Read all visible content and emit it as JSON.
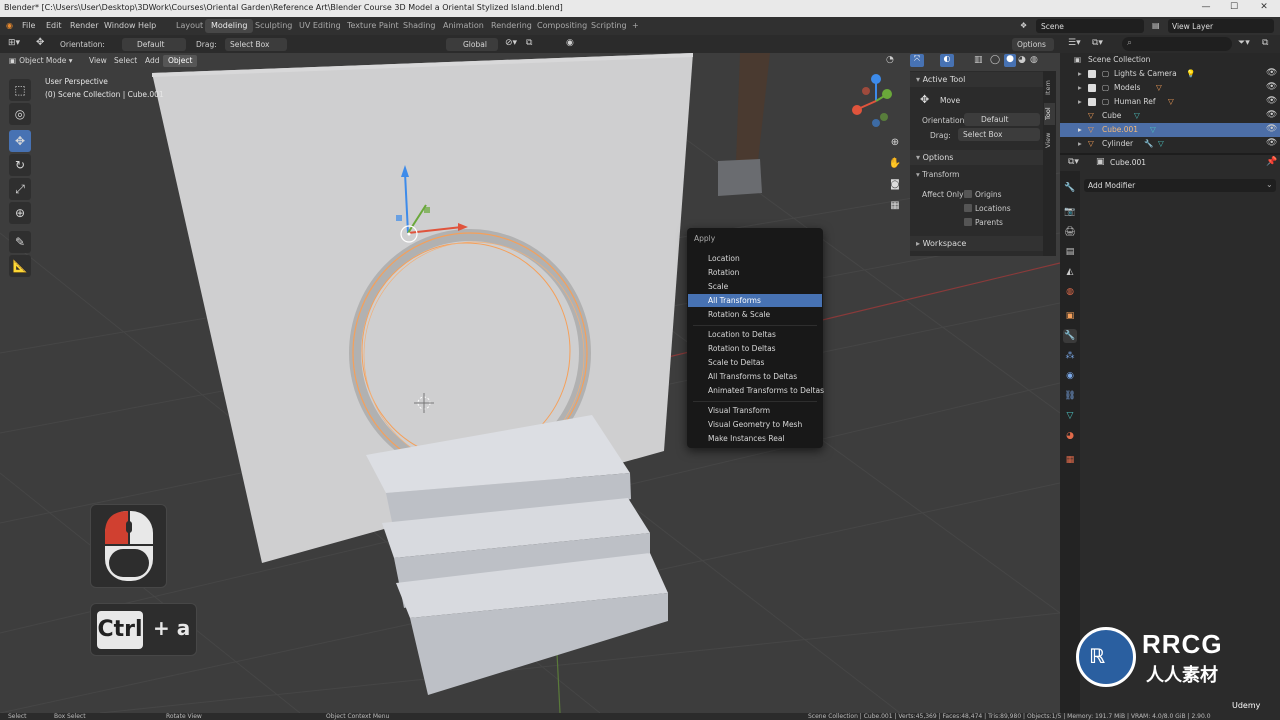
{
  "window": {
    "title": "Blender* [C:\\Users\\User\\Desktop\\3DWork\\Courses\\Oriental Garden\\Reference Art\\Blender Course 3D Model a Oriental Stylized Island.blend]",
    "minimize": "—",
    "maximize": "☐",
    "close": "✕"
  },
  "menubar": {
    "items": [
      "File",
      "Edit",
      "Render",
      "Window",
      "Help"
    ],
    "workspaces": [
      "Layout",
      "Modeling",
      "Sculpting",
      "UV Editing",
      "Texture Paint",
      "Shading",
      "Animation",
      "Rendering",
      "Compositing",
      "Scripting"
    ],
    "active_workspace": "Modeling",
    "add_tab": "+",
    "scene": "Scene",
    "view_layer": "View Layer"
  },
  "toolheader": {
    "orientation_label": "Orientation:",
    "orientation_value": "Default",
    "drag_label": "Drag:",
    "drag_value": "Select Box",
    "transform_orientation": "Global",
    "options": "Options"
  },
  "viewport": {
    "mode": "Object Mode",
    "menus": [
      "View",
      "Select",
      "Add",
      "Object"
    ],
    "active_menu": "Object",
    "perspective": "User Perspective",
    "collection_info": "(0) Scene Collection | Cube.001"
  },
  "gizmo": {
    "x": "X",
    "y": "Y",
    "z": "Z"
  },
  "npanel": {
    "tabs": [
      "Item",
      "Tool",
      "View"
    ],
    "active_tab": "Tool",
    "active_tool_header": "Active Tool",
    "tool_name": "Move",
    "orientation_label": "Orientation",
    "orientation_value": "Default",
    "drag_label": "Drag:",
    "drag_value": "Select Box",
    "options_header": "Options",
    "transform_header": "Transform",
    "affect_only_label": "Affect Only",
    "affect_options": [
      "Origins",
      "Locations",
      "Parents"
    ],
    "workspace_header": "Workspace"
  },
  "context_menu": {
    "title": "Apply",
    "groups": [
      [
        "Location",
        "Rotation",
        "Scale",
        "All Transforms",
        "Rotation & Scale"
      ],
      [
        "Location to Deltas",
        "Rotation to Deltas",
        "Scale to Deltas",
        "All Transforms to Deltas",
        "Animated Transforms to Deltas"
      ],
      [
        "Visual Transform",
        "Visual Geometry to Mesh",
        "Make Instances Real"
      ]
    ],
    "highlighted": "All Transforms"
  },
  "outliner": {
    "search_placeholder": "",
    "root": "Scene Collection",
    "items": [
      {
        "label": "Lights & Camera",
        "type": "collection"
      },
      {
        "label": "Models",
        "type": "collection"
      },
      {
        "label": "Human Ref",
        "type": "collection"
      },
      {
        "label": "Cube",
        "type": "object"
      },
      {
        "label": "Cube.001",
        "type": "object",
        "selected": true
      },
      {
        "label": "Cylinder",
        "type": "object"
      }
    ]
  },
  "properties": {
    "object_name": "Cube.001",
    "add_modifier": "Add Modifier"
  },
  "keycast": {
    "ctrl": "Ctrl",
    "plus": "+ a"
  },
  "statusbar": {
    "items": [
      "Select",
      "Box Select",
      "Rotate View",
      "Object Context Menu"
    ],
    "stats": "Scene Collection | Cube.001 | Verts:45,369 | Faces:48,474 | Tris:89,980 | Objects:1/5 | Memory: 191.7 MiB | VRAM: 4.0/8.0 GiB | 2.90.0"
  },
  "watermark": {
    "brand": "RRCG",
    "sub": "人人素材",
    "udemy": "Udemy"
  },
  "colors": {
    "accent": "#4772b3",
    "selection_outline": "#f5a05a",
    "bg_viewport": "#3d3d3d"
  }
}
